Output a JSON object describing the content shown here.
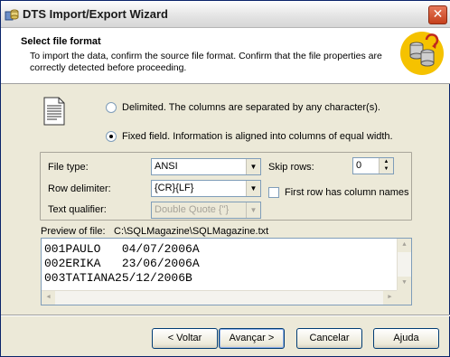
{
  "window": {
    "title": "DTS Import/Export Wizard",
    "close_glyph": "✕"
  },
  "header": {
    "title": "Select file format",
    "description": "To import the data, confirm the source file format.  Confirm that the file properties are correctly detected before proceeding."
  },
  "format": {
    "delimited_label": "Delimited.  The columns are separated by any character(s).",
    "delimited_selected": false,
    "fixed_label": "Fixed field.  Information is aligned into columns of equal width.",
    "fixed_selected": true
  },
  "options": {
    "file_type_label": "File type:",
    "file_type_value": "ANSI",
    "row_delimiter_label": "Row delimiter:",
    "row_delimiter_value": "{CR}{LF}",
    "text_qualifier_label": "Text qualifier:",
    "text_qualifier_value": "Double Quote {\"}",
    "skip_rows_label": "Skip rows:",
    "skip_rows_value": "0",
    "first_row_label": "First row has column names",
    "first_row_checked": false
  },
  "preview": {
    "label": "Preview of file:",
    "path": "C:\\SQLMagazine\\SQLMagazine.txt",
    "lines": [
      "001PAULO   04/07/2006A",
      "002ERIKA   23/06/2006A",
      "003TATIANA25/12/2006B"
    ]
  },
  "buttons": {
    "back": "< Voltar",
    "next": "Avançar >",
    "cancel": "Cancelar",
    "help": "Ajuda"
  },
  "icons": {
    "title_icon": "dts-wizard-icon",
    "header_icon": "database-transfer-icon",
    "file_icon": "text-document-icon"
  },
  "colors": {
    "title_close": "#d04a27",
    "header_bg": "#ffffff",
    "dialog_bg": "#ece9d8",
    "header_icon_bg": "#f5c200"
  }
}
